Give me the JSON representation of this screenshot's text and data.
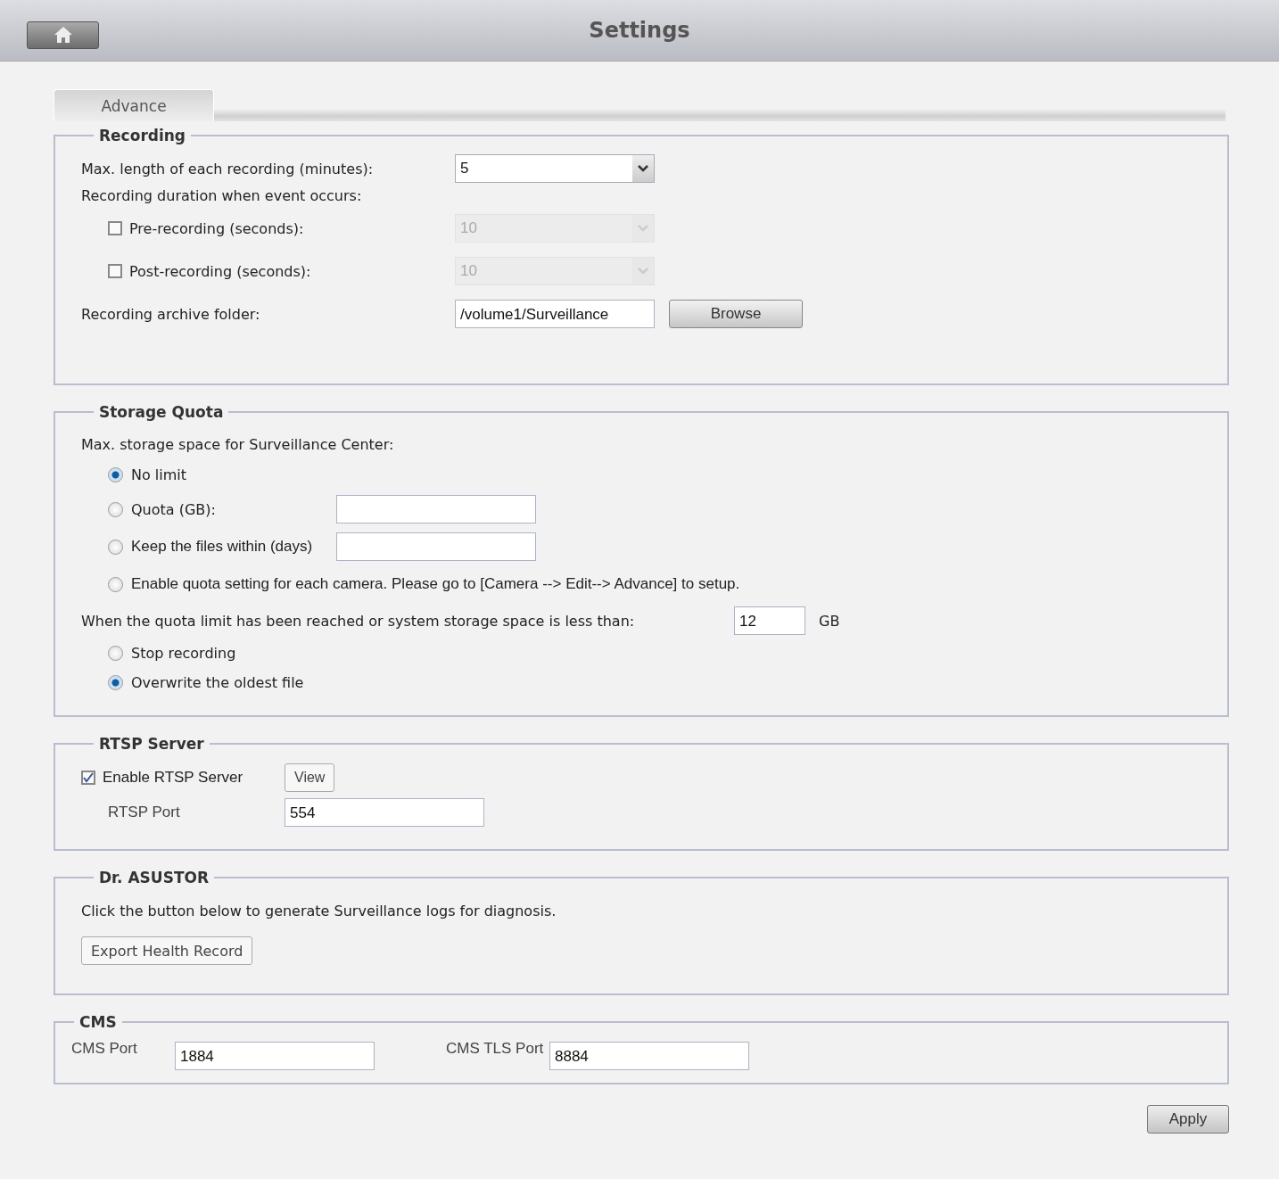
{
  "window": {
    "title": "Settings"
  },
  "tabs": [
    {
      "label": "Advance",
      "selected": true
    }
  ],
  "recording": {
    "title": "Recording",
    "max_length": {
      "label": "Max. length of each recording (minutes):",
      "value": "5"
    },
    "duration_label": "Recording duration when event occurs:",
    "timers": [
      {
        "label": "Pre-recording (seconds):",
        "checked": false,
        "value": "10"
      },
      {
        "label": "Post-recording (seconds):",
        "checked": false,
        "value": "10"
      }
    ],
    "folder": {
      "label": "Recording archive folder:",
      "value": "/volume1/Surveillance",
      "button": "Browse"
    }
  },
  "storage_quota": {
    "title": "Storage Quota",
    "label": "Max. storage space for Surveillance Center:",
    "options": [
      {
        "kind": "plain",
        "label": "No limit",
        "selected": true
      },
      {
        "kind": "field",
        "label": "Quota (GB):",
        "selected": false
      },
      {
        "kind": "field",
        "label": "Keep the files within (days)",
        "selected": false
      },
      {
        "kind": "plain",
        "label": "Enable quota setting for each camera. Please go to [Camera --> Edit--> Advance] to setup.",
        "selected": false
      }
    ],
    "threshold": {
      "label": "When the quota limit has been reached or system storage space is less than:",
      "value": "12",
      "unit": "GB"
    },
    "actions": [
      {
        "label": "Stop recording",
        "selected": false
      },
      {
        "label": "Overwrite the oldest file",
        "selected": true
      }
    ]
  },
  "rtsp": {
    "title": "RTSP Server",
    "enable": {
      "label": "Enable RTSP Server",
      "checked": true
    },
    "view_button": "View",
    "port": {
      "label": "RTSP Port",
      "value": "554"
    }
  },
  "dr_asustor": {
    "title": "Dr. ASUSTOR",
    "description": "Click the button below to generate Surveillance logs for diagnosis.",
    "button": "Export Health Record"
  },
  "cms": {
    "title": "CMS",
    "fields": [
      {
        "label": "CMS Port",
        "value": "1884"
      },
      {
        "label": "CMS TLS Port",
        "value": "8884"
      }
    ]
  },
  "apply_button": "Apply"
}
